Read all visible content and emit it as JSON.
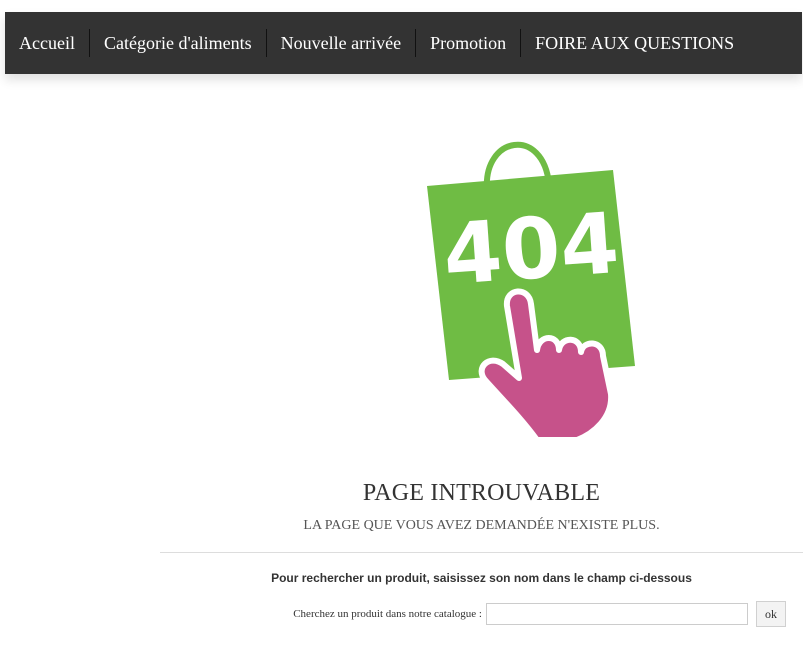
{
  "nav": {
    "items": [
      {
        "label": "Accueil"
      },
      {
        "label": "Catégorie d'aliments"
      },
      {
        "label": "Nouvelle arrivée"
      },
      {
        "label": "Promotion"
      },
      {
        "label": "FOIRE AUX QUESTIONS"
      }
    ]
  },
  "illustration": {
    "code": "404",
    "icon": "shopping-bag-404 with pointing-hand-icon",
    "colors": {
      "bag": "#6fbc44",
      "hand": "#c6528a",
      "text": "#ffffff"
    }
  },
  "error": {
    "title": "PAGE INTROUVABLE",
    "subtitle": "LA PAGE QUE VOUS AVEZ DEMANDÉE N'EXISTE PLUS."
  },
  "search": {
    "hint": "Pour rechercher un produit, saisissez son nom dans le champ ci-dessous",
    "label": "Cherchez un produit dans notre catalogue :",
    "value": "",
    "button": "ok"
  }
}
